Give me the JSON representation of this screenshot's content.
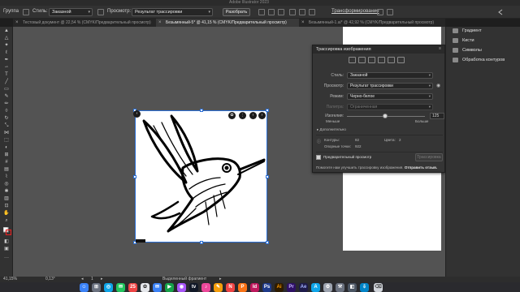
{
  "window": {
    "title": "Adobe Illustrator 2023"
  },
  "control_bar": {
    "group_label": "Группа",
    "style_label": "Стиль:",
    "style_value": "Заказной",
    "view_label": "Просмотр:",
    "view_value": "Результат трассировки",
    "expand_button": "Разобрать",
    "transform_link": "Трансформирование"
  },
  "tabs": [
    {
      "label": "Тестовый документ @ 22,54 % (CMYK/Предварительный просмотр)",
      "active": false
    },
    {
      "label": "Безымянный-5* @ 41,15 % (CMYK/Предварительный просмотр)",
      "active": true
    },
    {
      "label": "Безымянный-1.ai* @ 42,92 % (CMYK/Предварительный просмотр)",
      "active": false
    }
  ],
  "trace_panel": {
    "title": "Трассировка изображения",
    "preset_label": "Стиль:",
    "preset_value": "Заказной",
    "view_label": "Просмотр:",
    "view_value": "Результат трассировки",
    "mode_label": "Режим:",
    "mode_value": "Черно-белое",
    "palette_label": "Палитра:",
    "palette_value": "Ограниченная",
    "threshold_label": "Изогелия:",
    "threshold_value": "125",
    "threshold_fraction": 0.49,
    "less_label": "Меньше",
    "more_label": "Больше",
    "advanced_label": "Дополнительно",
    "paths_label": "Контуры:",
    "paths_value": "82",
    "colors_label": "Цвета:",
    "colors_value": "2",
    "anchors_label": "Опорные точки:",
    "anchors_value": "922",
    "preview_label": "Предварительный просмотр",
    "trace_button": "Трассировка",
    "help_text": "Помогите нам улучшить трассировку изображения.",
    "help_link": "Отправить отзыв."
  },
  "right_panels": [
    {
      "label": "Градиент",
      "icon": "gradient-icon"
    },
    {
      "label": "Кисти",
      "icon": "brush-icon"
    },
    {
      "label": "Символы",
      "icon": "symbols-icon"
    },
    {
      "label": "Обработка контуров",
      "icon": "pathfinder-icon"
    }
  ],
  "status_bar": {
    "zoom": "41,15%",
    "rotation": "0,13°",
    "page": "1",
    "selection": "Выделенный фрагмент"
  },
  "dock": [
    "Finder",
    "Launchpad",
    "Safari",
    "Сообщения",
    "Почта",
    "Карты",
    "Фото",
    "FaceTime",
    "Календарь",
    "Контакты",
    "Напоминания",
    "Заметки",
    "Музыка",
    "Подкасты",
    "TV",
    "News",
    "Pages",
    "InDesign",
    "Photoshop",
    "Illustrator",
    "Premiere",
    "After Effects",
    "App Store",
    "Настройки",
    "Загрузки",
    "Корзина"
  ],
  "dock_calendar_date": "25",
  "colors": {
    "accent": "#2b6fd6",
    "canvas": "#535353",
    "panel": "#353535"
  }
}
